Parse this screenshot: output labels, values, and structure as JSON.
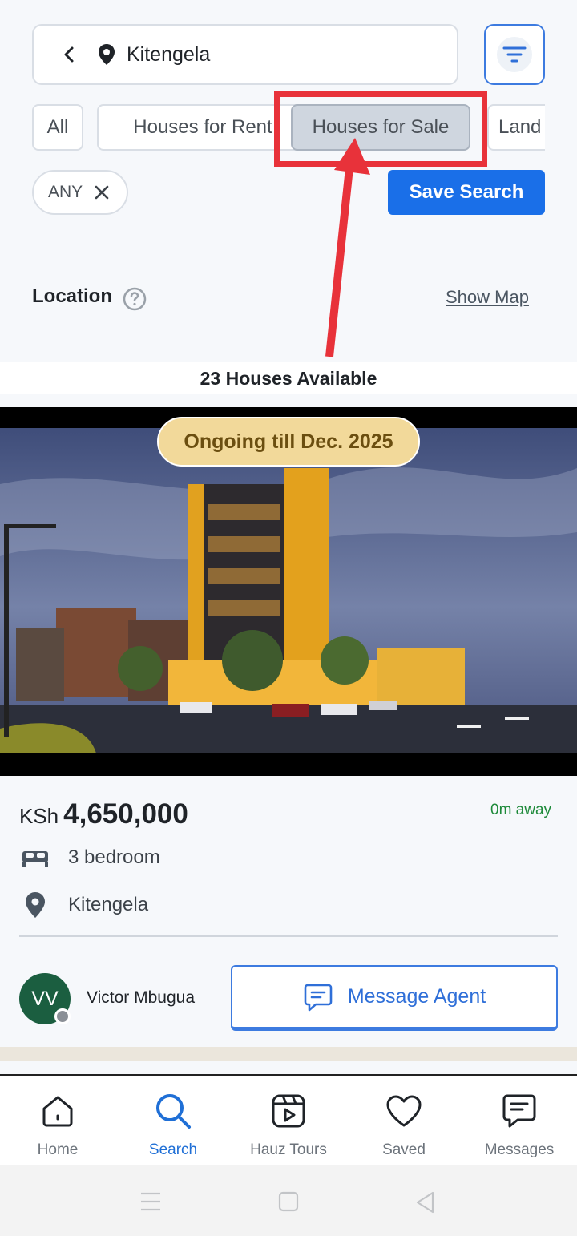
{
  "search": {
    "location": "Kitengela"
  },
  "categories": [
    "All",
    "Houses for Rent",
    "Houses for Sale",
    "Land"
  ],
  "selected_category": "Houses for Sale",
  "filter_chip": {
    "label": "ANY"
  },
  "save_search_label": "Save Search",
  "location_section": {
    "label": "Location",
    "show_map": "Show Map"
  },
  "results_count_label": "23 Houses Available",
  "listing": {
    "status_badge": "Ongoing  till Dec. 2025",
    "currency": "KSh",
    "price": "4,650,000",
    "distance": "0m away",
    "bedrooms": "3 bedroom",
    "location": "Kitengela",
    "agent": {
      "initials": "VV",
      "name": "Victor Mbugua"
    },
    "message_label": "Message Agent"
  },
  "tabs": [
    {
      "label": "Home",
      "icon": "home-icon"
    },
    {
      "label": "Search",
      "icon": "search-icon",
      "active": true
    },
    {
      "label": "Hauz Tours",
      "icon": "play-icon"
    },
    {
      "label": "Saved",
      "icon": "heart-icon"
    },
    {
      "label": "Messages",
      "icon": "message-icon"
    }
  ],
  "colors": {
    "accent": "#1a6fe8",
    "highlight": "#e8323a",
    "badge": "#f2d99a",
    "avatar": "#1b5e40",
    "distance": "#1e8a3a"
  }
}
